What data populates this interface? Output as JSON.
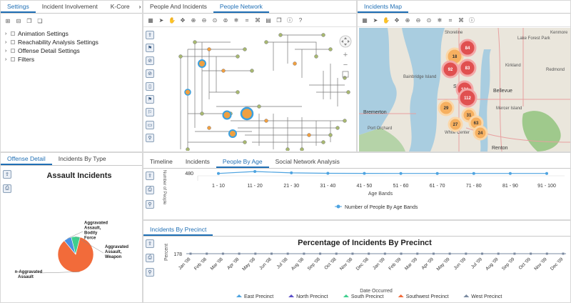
{
  "settings_panel": {
    "tabs": [
      "Settings",
      "Incident Involvement",
      "K-Core"
    ],
    "tab_overflow": "›",
    "tree_items": [
      "Animation Settings",
      "Reachability Analysis Settings",
      "Offense Detail Settings",
      "Filters"
    ]
  },
  "network_panel": {
    "tabs": [
      "People And Incidents",
      "People Network"
    ]
  },
  "map_panel": {
    "tabs": [
      "Incidents Map"
    ],
    "places": [
      "Shoreline",
      "Lake Forest Park",
      "Kenmore",
      "Kirkland",
      "Redmond",
      "Bainbridge Island",
      "Bremerton",
      "Port Orchard",
      "Bellevue",
      "Mercer Island",
      "White Center",
      "Renton",
      "Seattle"
    ],
    "clusters": [
      "18",
      "84",
      "92",
      "83",
      "124",
      "112",
      "29",
      "31",
      "63",
      "27",
      "24"
    ]
  },
  "offense_panel": {
    "tabs": [
      "Offense Detail",
      "Incidents By Type"
    ],
    "chart_data": {
      "type": "pie",
      "title": "Assault Incidents",
      "slices": [
        {
          "label": "Non-Aggravated Assault",
          "value": 85,
          "color": "#f26b3a"
        },
        {
          "label": "Aggravated Assault, Bodily Force",
          "value": 7,
          "color": "#4a90e2"
        },
        {
          "label": "Aggravated Assault, Weapon",
          "value": 8,
          "color": "#3ecf8e"
        }
      ]
    }
  },
  "age_panel": {
    "tabs": [
      "Timeline",
      "Incidents",
      "People By Age",
      "Social Network Analysis"
    ],
    "chart_data": {
      "type": "line",
      "ylabel": "Number of People",
      "xlabel": "Age Bands",
      "ytick": "480",
      "categories": [
        "1 - 10",
        "11 - 20",
        "21 - 30",
        "31 - 40",
        "41 - 50",
        "51 - 60",
        "61 - 70",
        "71 - 80",
        "81 - 90",
        "91 - 100"
      ],
      "series": [
        {
          "name": "Number of People By Age Bands",
          "values": [
            350,
            480,
            390,
            360,
            355,
            350,
            350,
            350,
            350,
            350
          ],
          "color": "#4da3e0"
        }
      ],
      "ylim": [
        0,
        480
      ]
    }
  },
  "precinct_panel": {
    "tabs": [
      "Incidents By Precinct"
    ],
    "chart_data": {
      "type": "line",
      "title": "Percentage of Incidents By Precinct",
      "ylabel": "Percent",
      "xlabel": "Date Occurred",
      "ytick": "178",
      "categories": [
        "Jan '08",
        "Feb '08",
        "Mar '08",
        "Apr '08",
        "May '08",
        "Jun '08",
        "Jul '08",
        "Aug '08",
        "Sep '08",
        "Oct '08",
        "Nov '08",
        "Dec '08",
        "Jan '09",
        "Feb '09",
        "Mar '09",
        "Apr '09",
        "May '09",
        "Jun '09",
        "Jul '09",
        "Aug '09",
        "Sep '09",
        "Oct '09",
        "Nov '09",
        "Dec '09"
      ],
      "series": [
        {
          "name": "East Precinct",
          "color": "#4da3e0"
        },
        {
          "name": "North Precinct",
          "color": "#5b4fc9"
        },
        {
          "name": "South Precinct",
          "color": "#3ecf8e"
        },
        {
          "name": "Southwest Precinct",
          "color": "#f26b3a"
        },
        {
          "name": "West Precinct",
          "color": "#7a8aa0"
        }
      ]
    }
  }
}
